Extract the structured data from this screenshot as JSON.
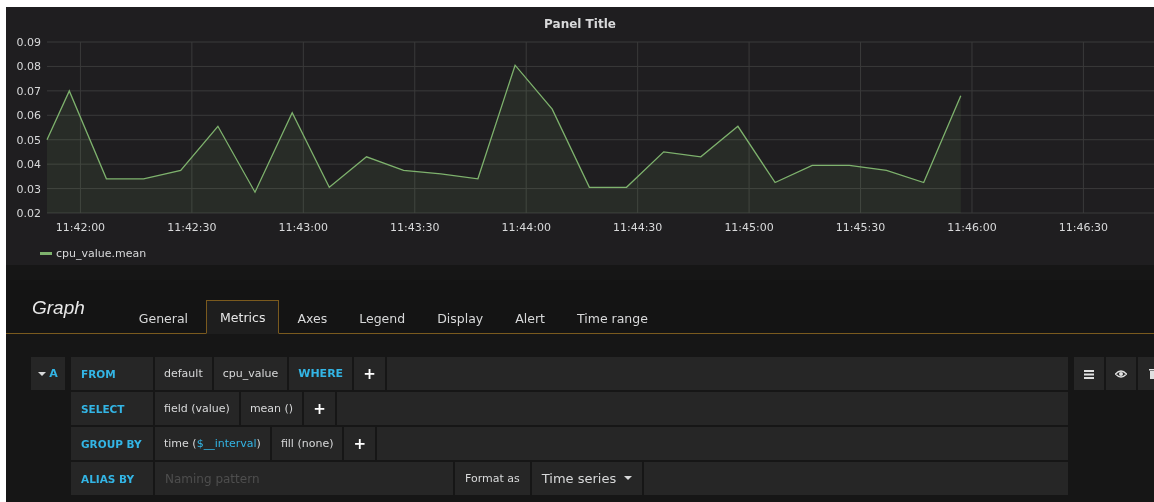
{
  "panel": {
    "title": "Panel Title",
    "chart_data": {
      "type": "area",
      "grid": true,
      "x": [
        42111,
        42117,
        42127,
        42137,
        42147,
        42157,
        42167,
        42177,
        42187,
        42197,
        42207,
        42217,
        42227,
        42237,
        42247,
        42257,
        42267,
        42277,
        42287,
        42297,
        42307,
        42317,
        42327,
        42337,
        42347,
        42357
      ],
      "series": [
        {
          "name": "cpu_value.mean",
          "color": "#7eb26d",
          "values": [
            0.05,
            0.07,
            0.034,
            0.034,
            0.0375,
            0.0555,
            0.0285,
            0.061,
            0.0305,
            0.043,
            0.0375,
            0.036,
            0.034,
            0.0805,
            0.0625,
            0.0305,
            0.0305,
            0.045,
            0.043,
            0.0555,
            0.0325,
            0.0395,
            0.0395,
            0.0375,
            0.0325,
            0.068
          ]
        }
      ],
      "xlim": [
        42111,
        42409
      ],
      "ylim": [
        0.02,
        0.09
      ],
      "xticks": [
        {
          "value": 42120,
          "label": "11:42:00"
        },
        {
          "value": 42150,
          "label": "11:42:30"
        },
        {
          "value": 42180,
          "label": "11:43:00"
        },
        {
          "value": 42210,
          "label": "11:43:30"
        },
        {
          "value": 42240,
          "label": "11:44:00"
        },
        {
          "value": 42270,
          "label": "11:44:30"
        },
        {
          "value": 42300,
          "label": "11:45:00"
        },
        {
          "value": 42330,
          "label": "11:45:30"
        },
        {
          "value": 42360,
          "label": "11:46:00"
        },
        {
          "value": 42390,
          "label": "11:46:30"
        }
      ],
      "yticks": [
        {
          "value": 0.02,
          "label": "0.02"
        },
        {
          "value": 0.03,
          "label": "0.03"
        },
        {
          "value": 0.04,
          "label": "0.04"
        },
        {
          "value": 0.05,
          "label": "0.05"
        },
        {
          "value": 0.06,
          "label": "0.06"
        },
        {
          "value": 0.07,
          "label": "0.07"
        },
        {
          "value": 0.08,
          "label": "0.08"
        },
        {
          "value": 0.09,
          "label": "0.09"
        }
      ]
    }
  },
  "editor": {
    "title": "Graph",
    "tabs": [
      {
        "label": "General",
        "selected": false
      },
      {
        "label": "Metrics",
        "selected": true
      },
      {
        "label": "Axes",
        "selected": false
      },
      {
        "label": "Legend",
        "selected": false
      },
      {
        "label": "Display",
        "selected": false
      },
      {
        "label": "Alert",
        "selected": false
      },
      {
        "label": "Time range",
        "selected": false
      }
    ]
  },
  "query": {
    "ref": "A",
    "expanded": true,
    "rows": [
      {
        "keyword": "FROM",
        "segments": [
          {
            "kind": "value",
            "parts": [
              {
                "text": "default"
              }
            ]
          },
          {
            "kind": "value",
            "parts": [
              {
                "text": "cpu_value"
              }
            ]
          },
          {
            "kind": "keyword",
            "parts": [
              {
                "text": "WHERE"
              }
            ]
          },
          {
            "kind": "plus",
            "parts": [
              {
                "text": "+"
              }
            ]
          }
        ]
      },
      {
        "keyword": "SELECT",
        "segments": [
          {
            "kind": "value",
            "parts": [
              {
                "text": "field (value)"
              }
            ]
          },
          {
            "kind": "value",
            "parts": [
              {
                "text": "mean ()"
              }
            ]
          },
          {
            "kind": "plus",
            "parts": [
              {
                "text": "+"
              }
            ]
          }
        ]
      },
      {
        "keyword": "GROUP BY",
        "segments": [
          {
            "kind": "value",
            "parts": [
              {
                "text": "time ("
              },
              {
                "text": "$__interval",
                "variable": true
              },
              {
                "text": ")"
              }
            ]
          },
          {
            "kind": "value",
            "parts": [
              {
                "text": "fill (none)"
              }
            ]
          },
          {
            "kind": "plus",
            "parts": [
              {
                "text": "+"
              }
            ]
          }
        ]
      }
    ],
    "alias": {
      "keyword": "ALIAS BY",
      "placeholder": "Naming pattern",
      "format_label": "Format as",
      "format_value": "Time series"
    }
  }
}
